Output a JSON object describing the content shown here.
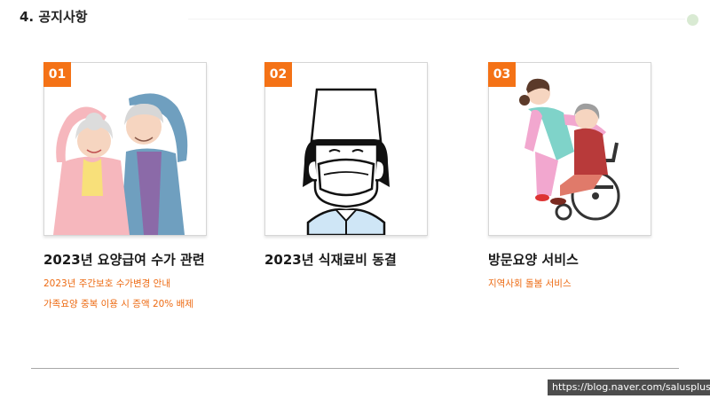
{
  "section": {
    "title": "4. 공지사항"
  },
  "cards": [
    {
      "number": "01",
      "title": "2023년 요양급여 수가 관련",
      "items": [
        "2023년 주간보호 수가변경 안내",
        "가족요양 중복 이용 시 증액 20% 배제"
      ],
      "image": "elderly-couple-illustration"
    },
    {
      "number": "02",
      "title": "2023년 식재료비 동결",
      "items": [],
      "image": "cook-with-mask-illustration"
    },
    {
      "number": "03",
      "title": "방문요양 서비스",
      "items": [
        "지역사회 돌봄 서비스"
      ],
      "image": "caregiver-wheelchair-illustration"
    }
  ],
  "footer": {
    "url": "https://blog.naver.com/salusplus"
  },
  "colors": {
    "accent": "#f47216",
    "sub_text": "#ed6a12",
    "divider": "#a8a8a8",
    "dot": "#d9ead3"
  }
}
